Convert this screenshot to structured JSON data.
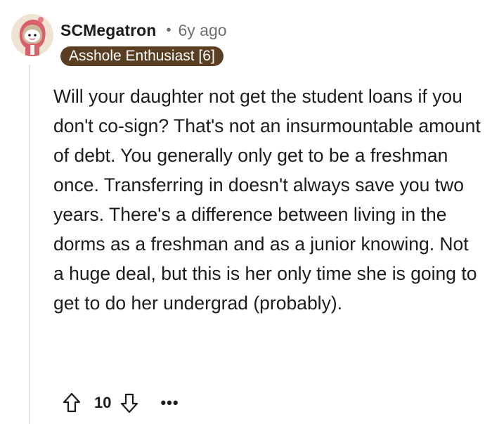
{
  "comment": {
    "username": "SCMegatron",
    "separator": "•",
    "timestamp": "6y ago",
    "flair": "Asshole Enthusiast [6]",
    "body": "Will your daughter not get the student loans if you don't co-sign? That's not an insurmountable amount of debt. You generally only get to be a freshman once. Transferring in doesn't always save you two years. There's a difference between living in the dorms as a freshman and as a junior knowing. Not a huge deal, but this is her only time she is going to get to do her undergrad (probably).",
    "score": "10",
    "more": "•••",
    "icons": {
      "avatar": "snoo-avatar-icon",
      "upvote": "upvote-arrow-icon",
      "downvote": "downvote-arrow-icon"
    },
    "colors": {
      "flair_background": "#5a3e22",
      "flair_text": "#ffffff",
      "meta_text": "#6b6f72",
      "thread_line": "#e3e5e8"
    }
  }
}
